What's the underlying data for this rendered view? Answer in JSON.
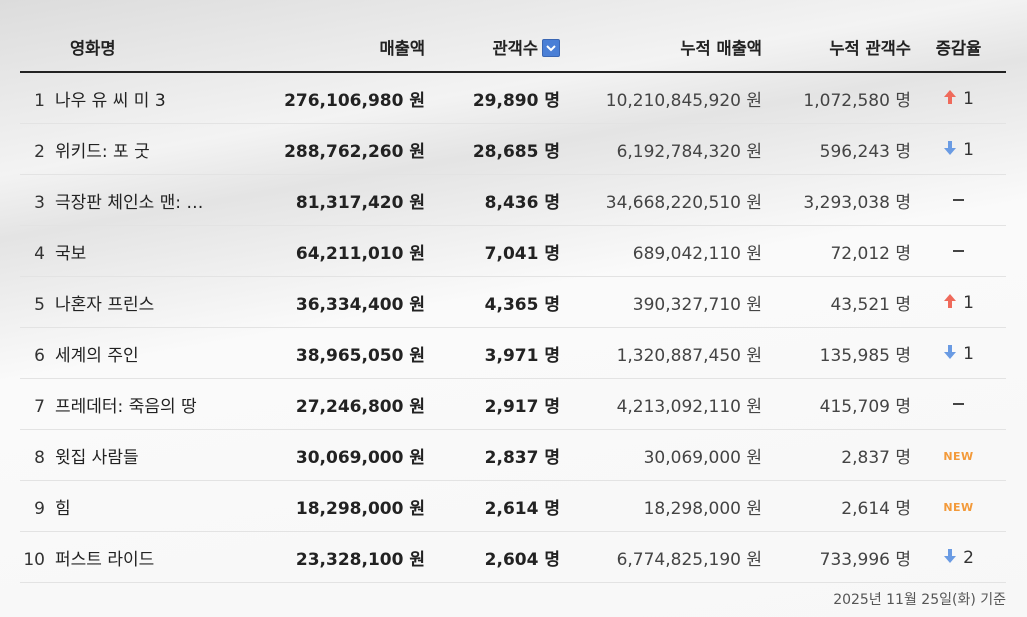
{
  "header": {
    "title": "영화명",
    "sales": "매출액",
    "audience": "관객수",
    "cum_sales": "누적 매출액",
    "cum_audience": "누적 관객수",
    "change": "증감율"
  },
  "rows": [
    {
      "rank": "1",
      "title": "나우 유 씨 미 3",
      "sales": "276,106,980 원",
      "audience": "29,890 명",
      "cum_sales": "10,210,845,920 원",
      "cum_audience": "1,072,580 명",
      "change_type": "up",
      "change_value": "1"
    },
    {
      "rank": "2",
      "title": "위키드: 포 굿",
      "sales": "288,762,260 원",
      "audience": "28,685 명",
      "cum_sales": "6,192,784,320 원",
      "cum_audience": "596,243 명",
      "change_type": "down",
      "change_value": "1"
    },
    {
      "rank": "3",
      "title": "극장판 체인소 맨: …",
      "sales": "81,317,420 원",
      "audience": "8,436 명",
      "cum_sales": "34,668,220,510 원",
      "cum_audience": "3,293,038 명",
      "change_type": "same",
      "change_value": ""
    },
    {
      "rank": "4",
      "title": "국보",
      "sales": "64,211,010 원",
      "audience": "7,041 명",
      "cum_sales": "689,042,110 원",
      "cum_audience": "72,012 명",
      "change_type": "same",
      "change_value": ""
    },
    {
      "rank": "5",
      "title": "나혼자 프린스",
      "sales": "36,334,400 원",
      "audience": "4,365 명",
      "cum_sales": "390,327,710 원",
      "cum_audience": "43,521 명",
      "change_type": "up",
      "change_value": "1"
    },
    {
      "rank": "6",
      "title": "세계의 주인",
      "sales": "38,965,050 원",
      "audience": "3,971 명",
      "cum_sales": "1,320,887,450 원",
      "cum_audience": "135,985 명",
      "change_type": "down",
      "change_value": "1"
    },
    {
      "rank": "7",
      "title": "프레데터: 죽음의 땅",
      "sales": "27,246,800 원",
      "audience": "2,917 명",
      "cum_sales": "4,213,092,110 원",
      "cum_audience": "415,709 명",
      "change_type": "same",
      "change_value": ""
    },
    {
      "rank": "8",
      "title": "윗집 사람들",
      "sales": "30,069,000 원",
      "audience": "2,837 명",
      "cum_sales": "30,069,000 원",
      "cum_audience": "2,837 명",
      "change_type": "new",
      "change_value": "NEW"
    },
    {
      "rank": "9",
      "title": "힘",
      "sales": "18,298,000 원",
      "audience": "2,614 명",
      "cum_sales": "18,298,000 원",
      "cum_audience": "2,614 명",
      "change_type": "new",
      "change_value": "NEW"
    },
    {
      "rank": "10",
      "title": "퍼스트 라이드",
      "sales": "23,328,100 원",
      "audience": "2,604 명",
      "cum_sales": "6,774,825,190 원",
      "cum_audience": "733,996 명",
      "change_type": "down",
      "change_value": "2"
    }
  ],
  "icons": {
    "sort": "chevron-down-icon",
    "up": "arrow-up-icon",
    "down": "arrow-down-icon",
    "same": "dash-icon"
  },
  "colors": {
    "sort_button": "#4a7fd6",
    "up": "#ef6a5b",
    "down": "#6a9be3",
    "new": "#f39a3a"
  },
  "footer": {
    "date_note": "2025년 11월 25일(화) 기준"
  }
}
